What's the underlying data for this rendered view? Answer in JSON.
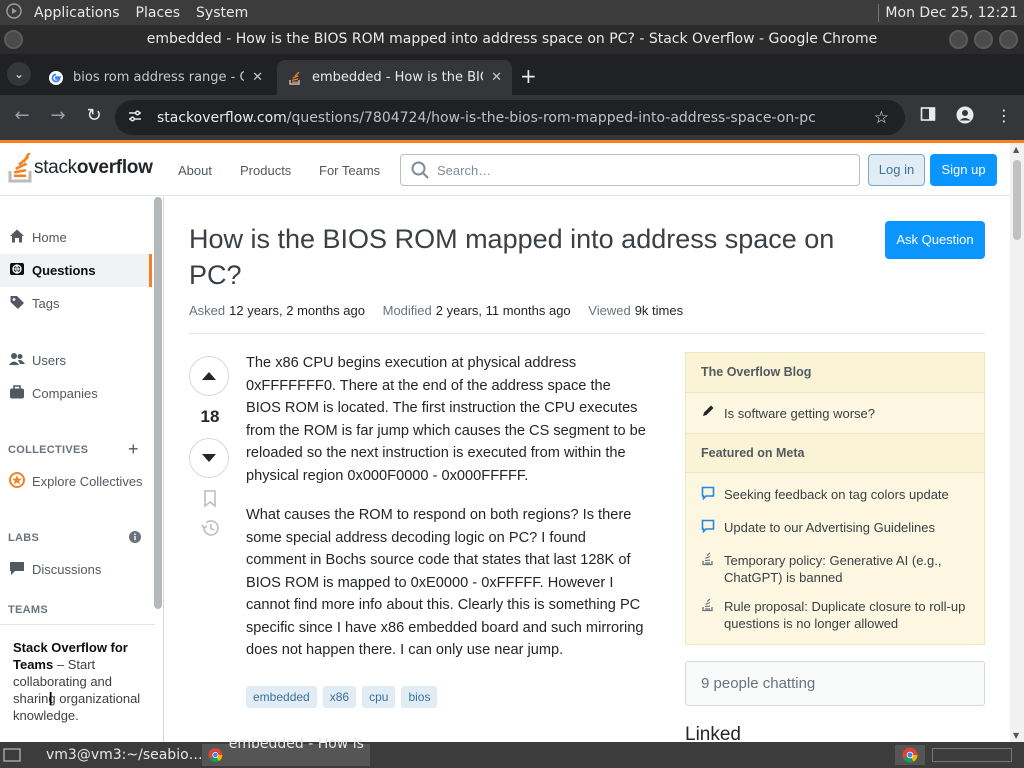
{
  "panel": {
    "menus": [
      "Applications",
      "Places",
      "System"
    ],
    "clock": "Mon Dec 25, 12:21"
  },
  "window": {
    "title": "embedded - How is the BIOS ROM mapped into address space on PC? - Stack Overflow - Google Chrome"
  },
  "tabs": [
    {
      "title": "bios rom address range - Google",
      "active": false
    },
    {
      "title": "embedded - How is the BIOS ROM",
      "active": true
    }
  ],
  "omnibox": {
    "host": "stackoverflow.com",
    "path": "/questions/7804724/how-is-the-bios-rom-mapped-into-address-space-on-pc"
  },
  "so_header": {
    "logo_light": "stack",
    "logo_bold": "overflow",
    "nav": [
      "About",
      "Products",
      "For Teams"
    ],
    "search_placeholder": "Search…",
    "login": "Log in",
    "signup": "Sign up"
  },
  "sidebar": {
    "items": [
      {
        "label": "Home",
        "icon": "home-icon"
      },
      {
        "label": "Questions",
        "icon": "globe-icon",
        "active": true
      },
      {
        "label": "Tags",
        "icon": "tag-icon"
      },
      {
        "label": "Users",
        "icon": "users-icon"
      },
      {
        "label": "Companies",
        "icon": "briefcase-icon"
      }
    ],
    "collectives_head": "COLLECTIVES",
    "explore_collectives": "Explore Collectives",
    "labs_head": "LABS",
    "discussions": "Discussions",
    "teams_head": "TEAMS",
    "teams_promo_bold": "Stack Overflow for Teams",
    "teams_promo_text": " – Start collaborating and sharing organizational knowledge."
  },
  "question": {
    "title": "How is the BIOS ROM mapped into address space on PC?",
    "ask_button": "Ask Question",
    "asked_label": "Asked",
    "asked_value": "12 years, 2 months ago",
    "modified_label": "Modified",
    "modified_value": "2 years, 11 months ago",
    "viewed_label": "Viewed",
    "viewed_value": "9k times",
    "votes": "18",
    "body_p1": "The x86 CPU begins execution at physical address 0xFFFFFFF0. There at the end of the address space the BIOS ROM is located. The first instruction the CPU executes from the ROM is far jump which causes the CS segment to be reloaded so the next instruction is executed from within the physical region 0x000F0000 - 0x000FFFFF.",
    "body_p2": "What causes the ROM to respond on both regions? Is there some special address decoding logic on PC? I found comment in Bochs source code that states that last 128K of BIOS ROM is mapped to 0xE0000 - 0xFFFFF. However I cannot find more info about this. Clearly this is something PC specific since I have x86 embedded board and such mirroring does not happen there. I can only use near jump.",
    "tags": [
      "embedded",
      "x86",
      "cpu",
      "bios"
    ]
  },
  "blog": {
    "head1": "The Overflow Blog",
    "item1": "Is software getting worse?",
    "head2": "Featured on Meta",
    "meta_items": [
      {
        "text": "Seeking feedback on tag colors update",
        "icon": "chat-bubble-icon"
      },
      {
        "text": "Update to our Advertising Guidelines",
        "icon": "chat-bubble-icon"
      },
      {
        "text": "Temporary policy: Generative AI (e.g., ChatGPT) is banned",
        "icon": "stack-icon"
      },
      {
        "text": "Rule proposal: Duplicate closure to roll-up questions is no longer allowed",
        "icon": "stack-icon"
      }
    ],
    "chatting": "9 people chatting",
    "linked": "Linked"
  },
  "taskbar": {
    "terminal": "vm3@vm3:~/seabio…",
    "chrome": "embedded - How is …"
  },
  "colors": {
    "accent_orange": "#f48225",
    "so_blue": "#0a95ff"
  }
}
